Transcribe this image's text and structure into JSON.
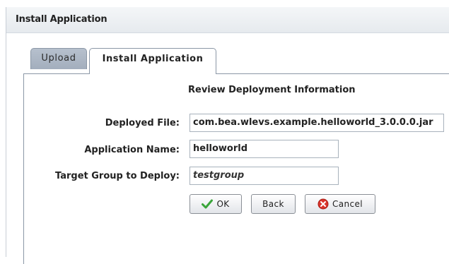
{
  "window": {
    "title": "Install Application"
  },
  "tabs": [
    {
      "label": "Upload",
      "active": false
    },
    {
      "label": "Install Application",
      "active": true
    }
  ],
  "form": {
    "section_title": "Review Deployment Information",
    "deployed_file": {
      "label": "Deployed File:",
      "value": "com.bea.wlevs.example.helloworld_3.0.0.0.jar"
    },
    "application_name": {
      "label": "Application Name:",
      "value": "helloworld"
    },
    "target_group": {
      "label": "Target Group to Deploy:",
      "value": "testgroup"
    }
  },
  "buttons": {
    "ok": {
      "label": "OK",
      "icon": "checkmark-icon"
    },
    "back": {
      "label": "Back"
    },
    "cancel": {
      "label": "Cancel",
      "icon": "cancel-x-icon"
    }
  },
  "colors": {
    "ok_icon": "#3aa53a",
    "cancel_icon": "#d9342b"
  }
}
